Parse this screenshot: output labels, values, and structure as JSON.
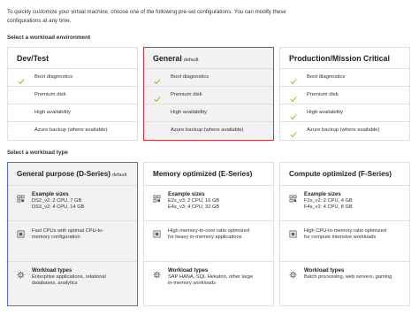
{
  "intro": {
    "line1": "To quickly customize your virtual machine, choose one of the following pre-set configurations. You can modify these",
    "line2": "configurations at any time."
  },
  "environment": {
    "label": "Select a workload environment",
    "cards": [
      {
        "title": "Dev/Test",
        "tag": "",
        "selected": false,
        "rows": [
          {
            "text": "Boot diagnostics",
            "checked": true
          },
          {
            "text": "Premium disk",
            "checked": false
          },
          {
            "text": "High availability",
            "checked": false
          },
          {
            "text": "Azure backup (where available)",
            "checked": false
          }
        ]
      },
      {
        "title": "General",
        "tag": "default",
        "selected": true,
        "rows": [
          {
            "text": "Boot diagnostics",
            "checked": true
          },
          {
            "text": "Premium disk",
            "checked": true
          },
          {
            "text": "High availability",
            "checked": false
          },
          {
            "text": "Azure backup (where available)",
            "checked": false
          }
        ]
      },
      {
        "title": "Production/Mission Critical",
        "tag": "",
        "selected": false,
        "rows": [
          {
            "text": "Boot diagnostics",
            "checked": true
          },
          {
            "text": "Premium disk",
            "checked": true
          },
          {
            "text": "High availability",
            "checked": true
          },
          {
            "text": "Azure backup (where available)",
            "checked": true
          }
        ]
      }
    ]
  },
  "workload": {
    "label": "Select a workload type",
    "cards": [
      {
        "title": "General purpose (D-Series)",
        "tag": "default",
        "selected": true,
        "sizes_heading": "Example sizes",
        "sizes": [
          "DS2_v2: 2 CPU, 7 GB",
          "DS3_v2: 4 CPU, 14 GB"
        ],
        "feature_lines": [
          "Fast CPUs with optimal CPU-to-",
          "memory configuration"
        ],
        "types_heading": "Workload types",
        "types_lines": [
          "Enterprise applications, relational",
          "databases, analytics"
        ]
      },
      {
        "title": "Memory optimized (E-Series)",
        "tag": "",
        "selected": false,
        "sizes_heading": "Example sizes",
        "sizes": [
          "E2s_v3: 2 CPU, 16 GB",
          "E4s_v3: 4 CPU, 32 GB"
        ],
        "feature_lines": [
          "High memory-to-core ratio optimized",
          "for heavy in-memory applications"
        ],
        "types_heading": "Workload types",
        "types_lines": [
          "SAP HANA, SQL Hekaton, other large",
          "in-memory workloads"
        ]
      },
      {
        "title": "Compute optimized (F-Series)",
        "tag": "",
        "selected": false,
        "sizes_heading": "Example sizes",
        "sizes": [
          "F2s_v2: 2 CPU, 4 GB",
          "F4s_v2: 4 CPU, 8 GB"
        ],
        "feature_lines": [
          "High CPU-to-memory ratio optimized",
          "for compute intensive workloads"
        ],
        "types_heading": "Workload types",
        "types_lines": [
          "Batch processing, web servers, gaming"
        ]
      }
    ]
  },
  "colors": {
    "check": "#8cbd18",
    "env_selected_border": "#d13438",
    "type_selected_border": "#4f6bed",
    "selected_bg": "#f2f2f2"
  }
}
